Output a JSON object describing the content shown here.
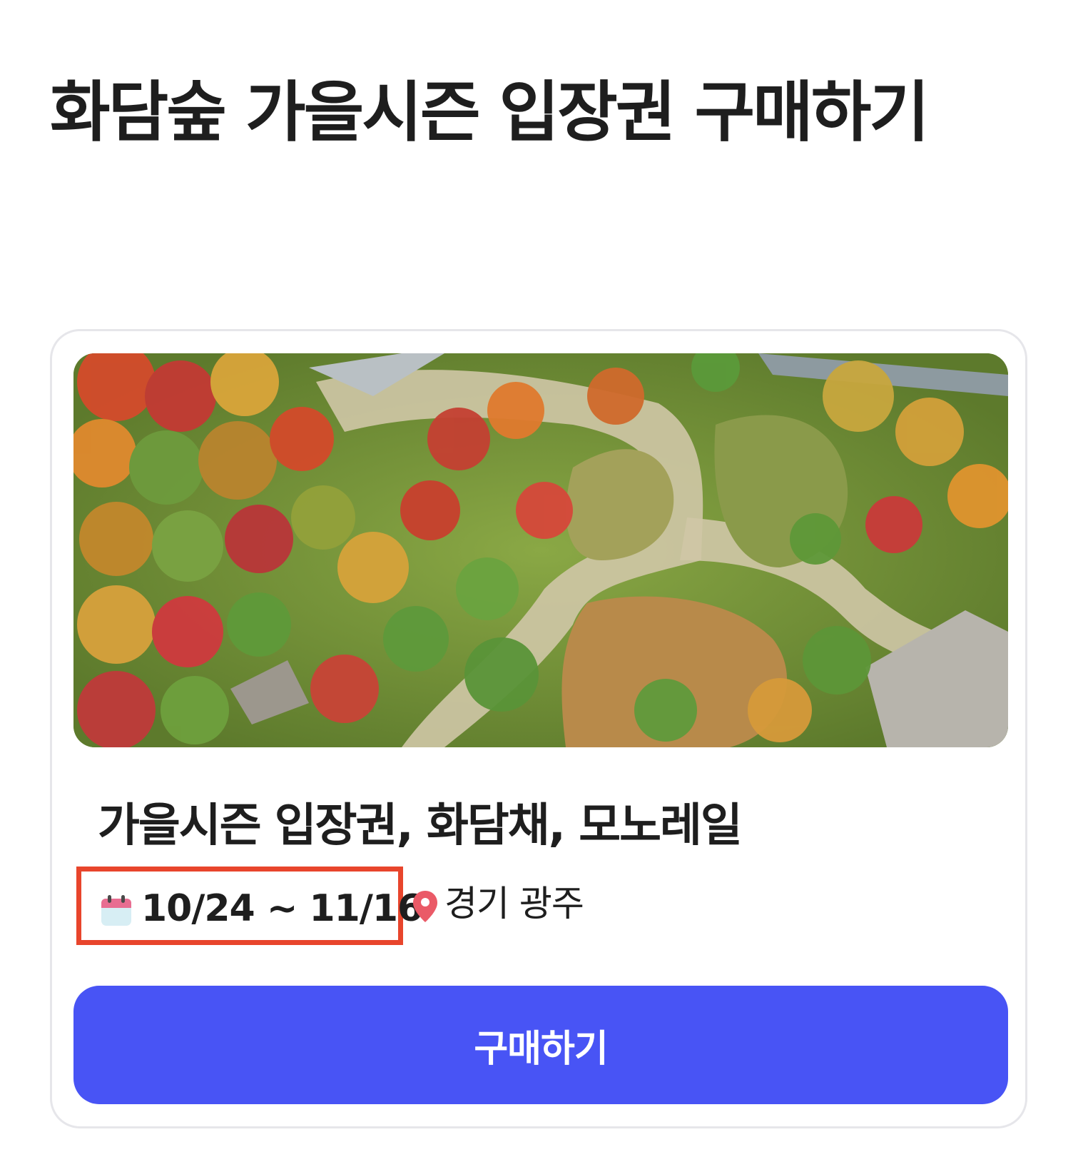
{
  "page": {
    "title": "화담숲 가을시즌 입장권 구매하기"
  },
  "card": {
    "image_alt": "autumn-forest-aerial-photo",
    "product_title": "가을시즌 입장권, 화담채, 모노레일",
    "date_range": "10/24 ~ 11/16",
    "location": "경기 광주",
    "buy_label": "구매하기",
    "icons": {
      "date": "calendar-icon",
      "location": "map-pin-icon"
    }
  },
  "colors": {
    "accent": "#4854f5",
    "highlight_border": "#e8452c",
    "pin": "#ea5a67",
    "text": "#1e1e1e"
  }
}
